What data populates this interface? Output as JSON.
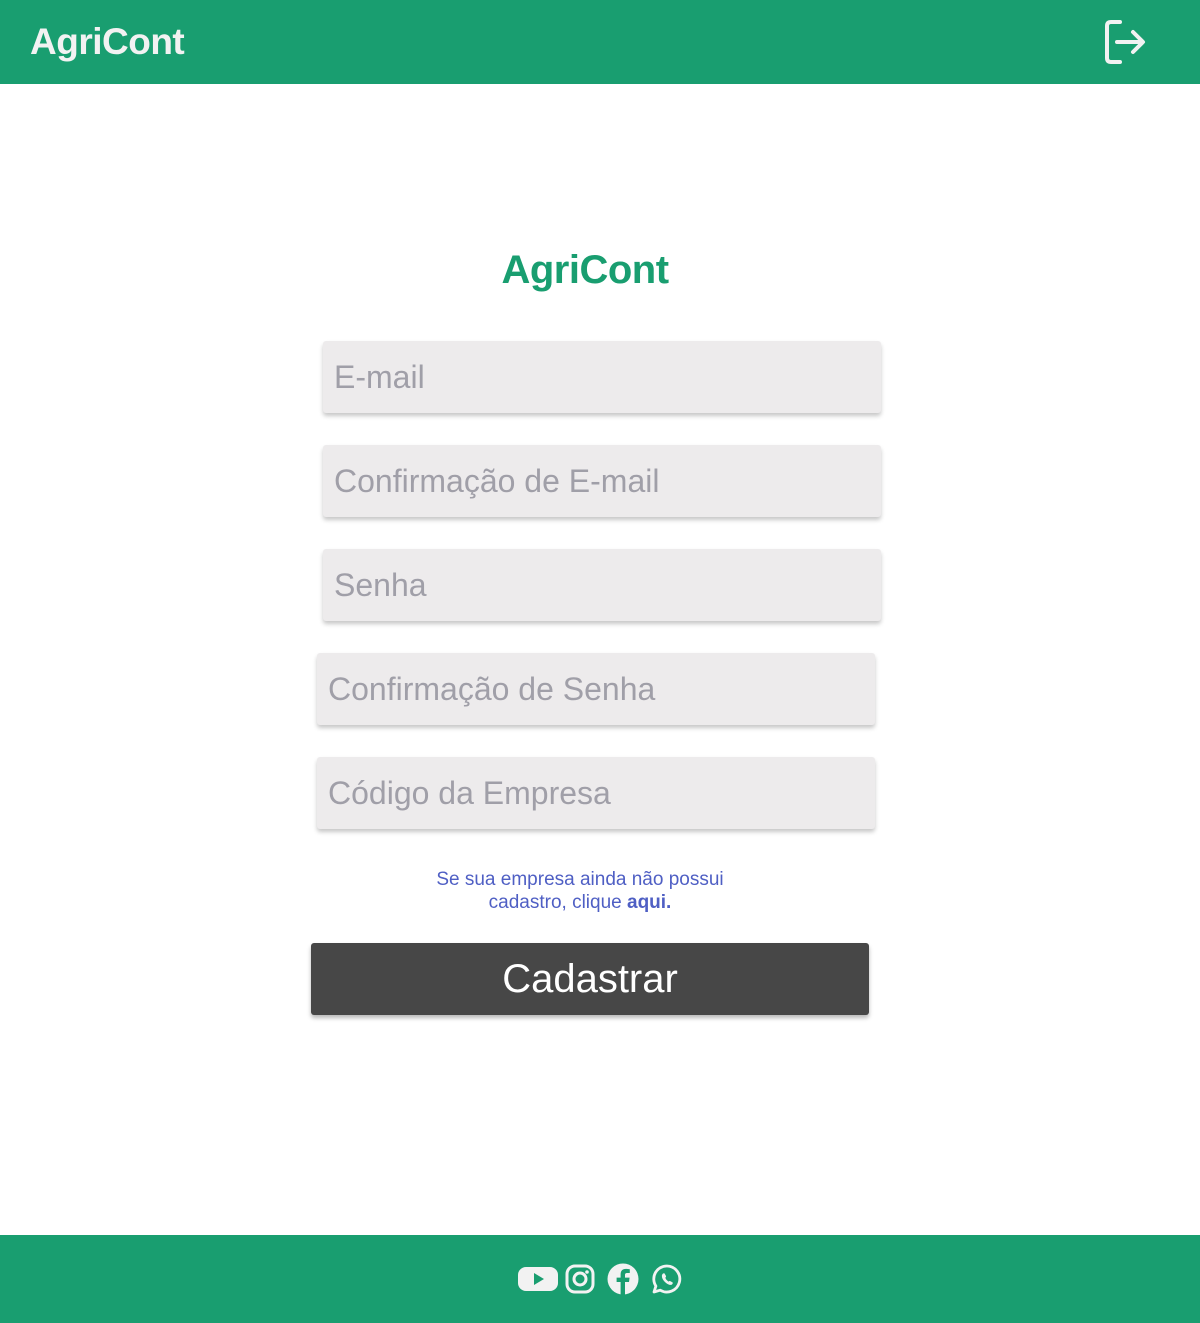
{
  "header": {
    "app_title": "AgriCont",
    "logout_icon": "logout-icon"
  },
  "form": {
    "title": "AgriCont",
    "fields": {
      "email": {
        "placeholder": "E-mail",
        "value": ""
      },
      "email_confirm": {
        "placeholder": "Confirmação de E-mail",
        "value": ""
      },
      "password": {
        "placeholder": "Senha",
        "value": ""
      },
      "password_confirm": {
        "placeholder": "Confirmação de Senha",
        "value": ""
      },
      "company_code": {
        "placeholder": "Código da Empresa",
        "value": ""
      }
    },
    "hint_line1": "Se sua empresa ainda não possui",
    "hint_line2": "cadastro, clique ",
    "hint_link": "aqui.",
    "submit_label": "Cadastrar"
  },
  "footer": {
    "social_icons": [
      "youtube-icon",
      "instagram-icon",
      "facebook-icon",
      "whatsapp-icon"
    ]
  },
  "colors": {
    "brand_green": "#199e70",
    "input_bg": "#edebec",
    "placeholder": "#a09fa8",
    "button_bg": "#474747",
    "link_blue": "#4f5fc4"
  }
}
